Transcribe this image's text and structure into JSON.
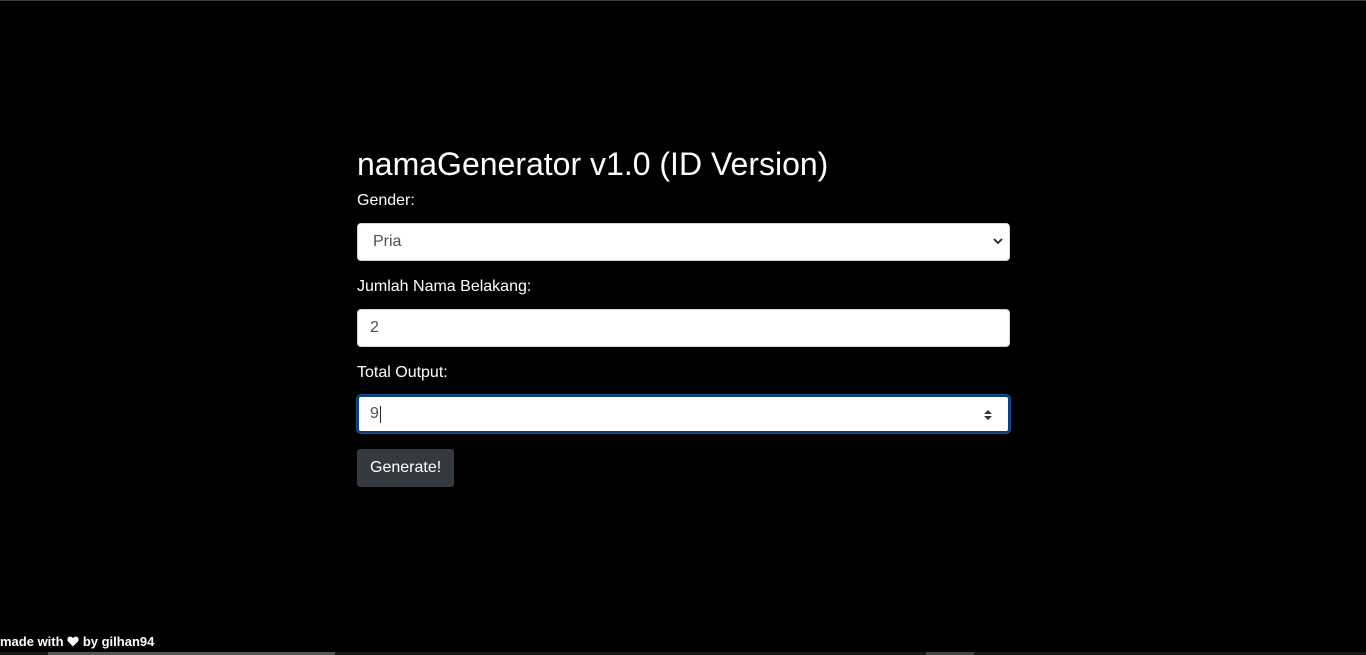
{
  "app": {
    "title": "namaGenerator v1.0 (ID Version)"
  },
  "form": {
    "gender": {
      "label": "Gender:",
      "selected": "Pria"
    },
    "surname_count": {
      "label": "Jumlah Nama Belakang:",
      "value": "2"
    },
    "total_output": {
      "label": "Total Output:",
      "value": "9"
    },
    "generate_label": "Generate!"
  },
  "footer": {
    "prefix": "made with",
    "suffix": "by gilhan94"
  },
  "colors": {
    "background": "#000000",
    "button": "#343a40",
    "focus_border": "#0d3d78"
  }
}
